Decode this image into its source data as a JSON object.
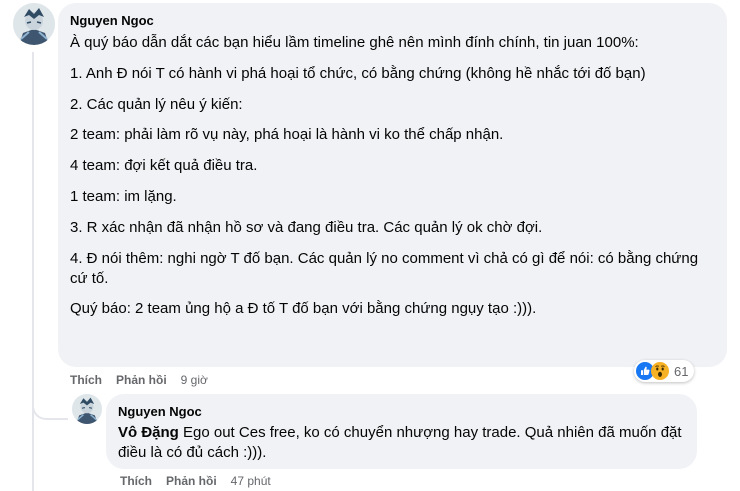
{
  "comment": {
    "author": "Nguyen Ngoc",
    "paragraphs": [
      "À quý báo dẫn dắt các bạn hiểu lầm timeline ghê nên mình đính chính, tin juan 100%:",
      "1. Anh Đ nói T có hành vi phá hoại tổ chức, có bằng chứng (không hề nhắc tới đố bạn)",
      "2. Các quản lý nêu ý kiến:",
      "2 team: phải làm rõ vụ này, phá hoại là hành vi ko thể chấp nhận.",
      "4 team: đợi kết quả điều tra.",
      "1 team: im lặng.",
      "3. R xác nhận đã nhận hồ sơ và đang điều tra. Các quản lý ok chờ đợi.",
      "4. Đ nói thêm: nghi ngờ T đố bạn. Các quản lý no comment vì chả có gì để nói: có bằng chứng cứ tố.",
      "Quý báo: 2 team ủng hộ a Đ tố T đố bạn với bằng chứng ngụy tạo :)))."
    ],
    "actions": {
      "like": "Thích",
      "reply": "Phản hồi",
      "time": "9 giờ"
    },
    "reactions": {
      "icons": [
        "like-icon",
        "wow-icon"
      ],
      "count": "61",
      "like_color": "#1877f2",
      "wow_color": "#f7b125"
    }
  },
  "reply": {
    "author": "Nguyen Ngoc",
    "mention": "Vô Đặng",
    "text": " Ego out Ces free, ko có chuyển nhượng hay trade. Quả nhiên đã muốn đặt điều là có đủ cách :))).",
    "actions": {
      "like": "Thích",
      "reply": "Phản hồi",
      "time": "47 phút"
    }
  },
  "colors": {
    "bubble": "#f0f2f5",
    "meta_text": "#65676b",
    "text": "#050505"
  }
}
